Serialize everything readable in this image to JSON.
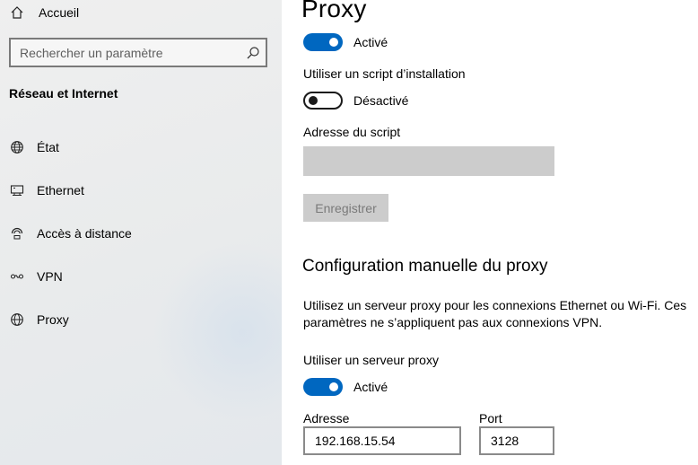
{
  "sidebar": {
    "home_label": "Accueil",
    "search_placeholder": "Rechercher un paramètre",
    "section_title": "Réseau et Internet",
    "items": [
      {
        "label": "État",
        "icon": "globe-status-icon"
      },
      {
        "label": "Ethernet",
        "icon": "ethernet-icon"
      },
      {
        "label": "Accès à distance",
        "icon": "dialup-icon"
      },
      {
        "label": "VPN",
        "icon": "vpn-icon"
      },
      {
        "label": "Proxy",
        "icon": "globe-icon"
      }
    ]
  },
  "main": {
    "title": "Proxy",
    "auto_detect_toggle": {
      "state": "on",
      "text": "Activé"
    },
    "setup_script": {
      "label": "Utiliser un script d’installation",
      "toggle": {
        "state": "off",
        "text": "Désactivé"
      },
      "address_label": "Adresse du script",
      "address_value": "",
      "save_label": "Enregistrer"
    },
    "manual": {
      "title": "Configuration manuelle du proxy",
      "description": "Utilisez un serveur proxy pour les connexions Ethernet ou Wi-Fi. Ces paramètres ne s’appliquent pas aux connexions VPN.",
      "use_proxy_label": "Utiliser un serveur proxy",
      "use_proxy_toggle": {
        "state": "on",
        "text": "Activé"
      },
      "address_label": "Adresse",
      "address_value": "192.168.15.54",
      "port_label": "Port",
      "port_value": "3128"
    }
  },
  "colors": {
    "accent": "#0067c0",
    "disabled_bg": "#cccccc",
    "sidebar_bg": "#ececec"
  }
}
